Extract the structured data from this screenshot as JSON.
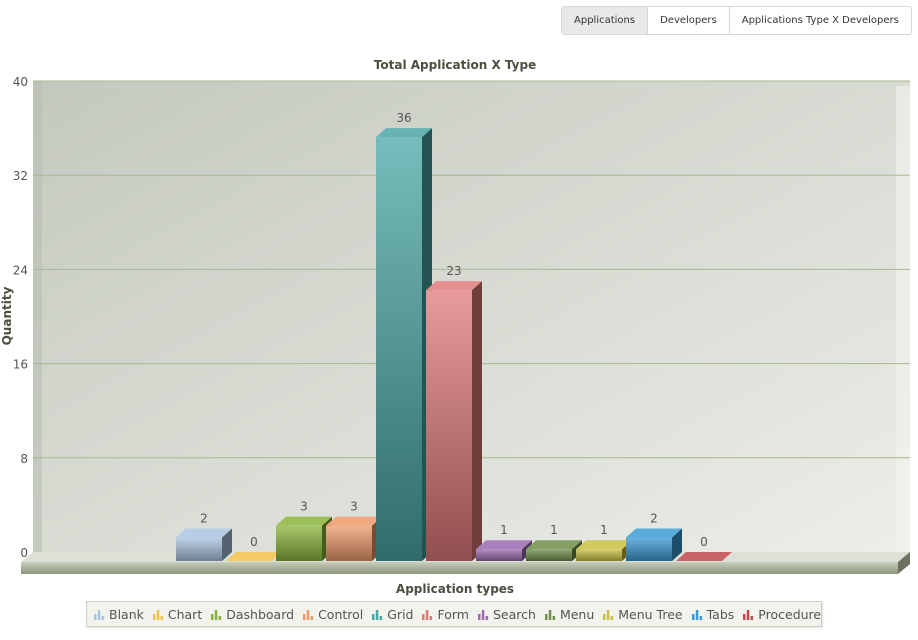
{
  "tabs": [
    {
      "label": "Applications",
      "active": true
    },
    {
      "label": "Developers",
      "active": false
    },
    {
      "label": "Applications Type X Developers",
      "active": false
    }
  ],
  "chart_data": {
    "type": "bar",
    "style": "3d-column",
    "title": "Total Application X Type",
    "xlabel": "Application types",
    "ylabel": "Quantity",
    "ylim": [
      0,
      40
    ],
    "yticks": [
      0,
      8,
      16,
      24,
      32,
      40
    ],
    "grid": true,
    "legend_position": "bottom",
    "categories": [
      "Blank",
      "Chart",
      "Dashboard",
      "Control",
      "Grid",
      "Form",
      "Search",
      "Menu",
      "Menu Tree",
      "Tabs",
      "Procedure"
    ],
    "values": [
      2,
      0,
      3,
      3,
      36,
      23,
      1,
      1,
      1,
      2,
      0
    ],
    "colors": [
      "#a9c4e0",
      "#f2c14a",
      "#8ab43a",
      "#ee9a6a",
      "#4aa6a6",
      "#e07a7a",
      "#9b6ab0",
      "#6f8f4a",
      "#c9c040",
      "#3a9bd5",
      "#c0484c"
    ],
    "legend": [
      "Blank",
      "Chart",
      "Dashboard",
      "Control",
      "Grid",
      "Form",
      "Search",
      "Menu",
      "Menu Tree",
      "Tabs",
      "Procedure"
    ]
  }
}
